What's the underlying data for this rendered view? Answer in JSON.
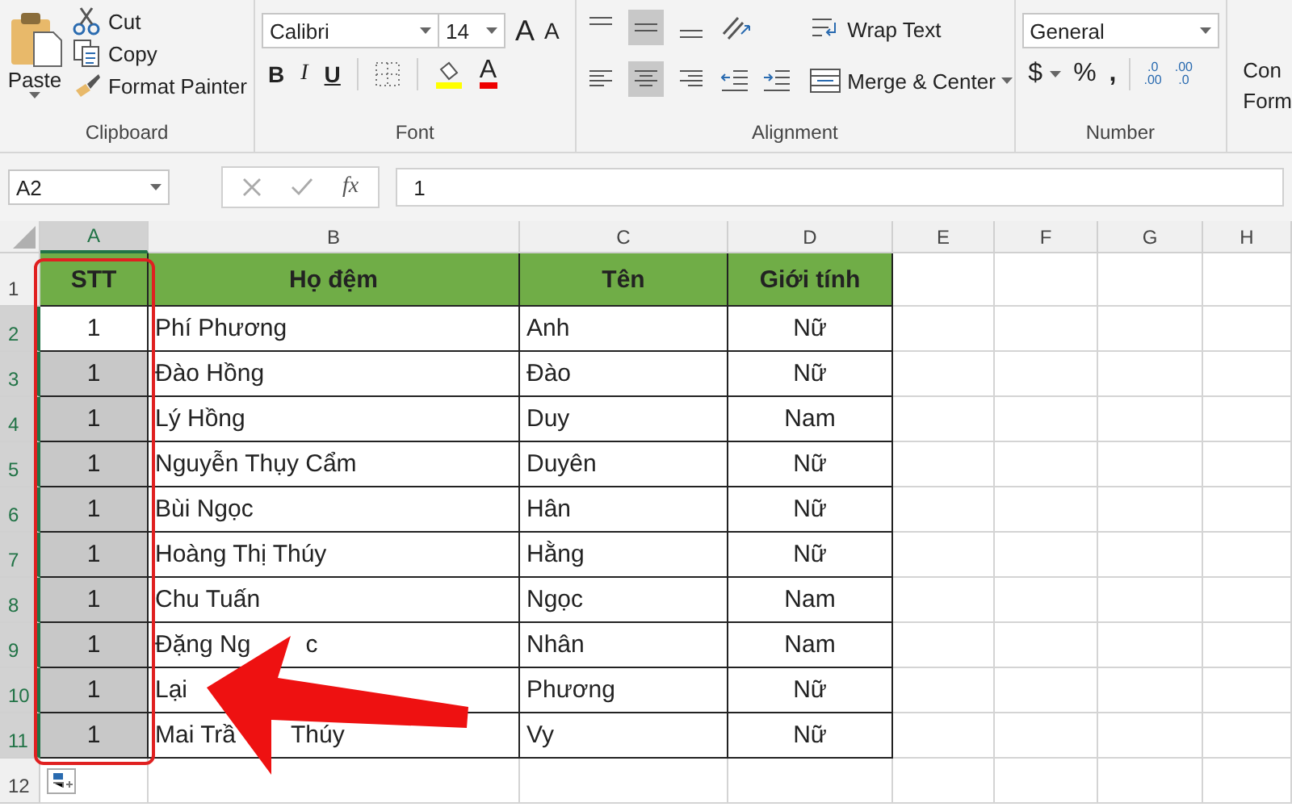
{
  "ribbon": {
    "clipboard": {
      "paste": "Paste",
      "cut": "Cut",
      "copy": "Copy",
      "format_painter": "Format Painter",
      "label": "Clipboard"
    },
    "font": {
      "name": "Calibri",
      "size": "14",
      "bold": "B",
      "italic": "I",
      "underline": "U",
      "grow": "A",
      "shrink": "A",
      "font_color": "A",
      "label": "Font"
    },
    "alignment": {
      "vertical": [
        {
          "kind": "top",
          "selected": false
        },
        {
          "kind": "middle",
          "selected": true
        },
        {
          "kind": "bottom",
          "selected": false
        }
      ],
      "horizontal": [
        {
          "kind": "left",
          "selected": false
        },
        {
          "kind": "center",
          "selected": true
        },
        {
          "kind": "right",
          "selected": false
        }
      ],
      "wrap_text": "Wrap Text",
      "merge_center": "Merge & Center",
      "label": "Alignment"
    },
    "number": {
      "format": "General",
      "currency": "$",
      "percent": "%",
      "comma": ",",
      "increase_decimal": [
        ".0",
        ".00"
      ],
      "decrease_decimal": [
        ".00",
        ".0"
      ],
      "label": "Number"
    },
    "conditional": [
      "Con",
      "Form"
    ]
  },
  "formula_bar": {
    "name_box": "A2",
    "fx": "fx",
    "value": "1"
  },
  "sheet": {
    "columns": [
      {
        "label": "A",
        "selected": true
      },
      {
        "label": "B",
        "selected": false
      },
      {
        "label": "C",
        "selected": false
      },
      {
        "label": "D",
        "selected": false
      },
      {
        "label": "E",
        "selected": false
      },
      {
        "label": "F",
        "selected": false
      },
      {
        "label": "G",
        "selected": false
      },
      {
        "label": "H",
        "selected": false
      }
    ],
    "header_row": {
      "number": "1",
      "cells": [
        "STT",
        "Họ đệm",
        "Tên",
        "Giới tính"
      ]
    },
    "rows": [
      {
        "number": "2",
        "stt": "1",
        "ho_dem": [
          "Phí Phương"
        ],
        "ten": "Anh",
        "gioi_tinh": "Nữ",
        "active": true,
        "selected": true
      },
      {
        "number": "3",
        "stt": "1",
        "ho_dem": [
          "Đào Hồng"
        ],
        "ten": "Đào",
        "gioi_tinh": "Nữ",
        "active": false,
        "selected": true
      },
      {
        "number": "4",
        "stt": "1",
        "ho_dem": [
          "Lý Hồng"
        ],
        "ten": "Duy",
        "gioi_tinh": "Nam",
        "active": false,
        "selected": true
      },
      {
        "number": "5",
        "stt": "1",
        "ho_dem": [
          "Nguyễn Thụy Cẩm"
        ],
        "ten": "Duyên",
        "gioi_tinh": "Nữ",
        "active": false,
        "selected": true
      },
      {
        "number": "6",
        "stt": "1",
        "ho_dem": [
          "Bùi Ngọc"
        ],
        "ten": "Hân",
        "gioi_tinh": "Nữ",
        "active": false,
        "selected": true
      },
      {
        "number": "7",
        "stt": "1",
        "ho_dem": [
          "Hoàng Thị Thúy"
        ],
        "ten": "Hằng",
        "gioi_tinh": "Nữ",
        "active": false,
        "selected": true
      },
      {
        "number": "8",
        "stt": "1",
        "ho_dem": [
          "Chu Tuấn"
        ],
        "ten": "Ngọc",
        "gioi_tinh": "Nam",
        "active": false,
        "selected": true
      },
      {
        "number": "9",
        "stt": "1",
        "ho_dem": [
          "Đặng Ng",
          "c"
        ],
        "ten": "Nhân",
        "gioi_tinh": "Nam",
        "active": false,
        "selected": true
      },
      {
        "number": "10",
        "stt": "1",
        "ho_dem": [
          "Lại"
        ],
        "ten": "Phương",
        "gioi_tinh": "Nữ",
        "active": false,
        "selected": true
      },
      {
        "number": "11",
        "stt": "1",
        "ho_dem": [
          "Mai Trầ",
          "Thúy"
        ],
        "ten": "Vy",
        "gioi_tinh": "Nữ",
        "active": false,
        "selected": true
      }
    ],
    "last_row": {
      "number": "12",
      "selected": false
    }
  },
  "annotation": {
    "highlight": true,
    "arrow": true
  }
}
